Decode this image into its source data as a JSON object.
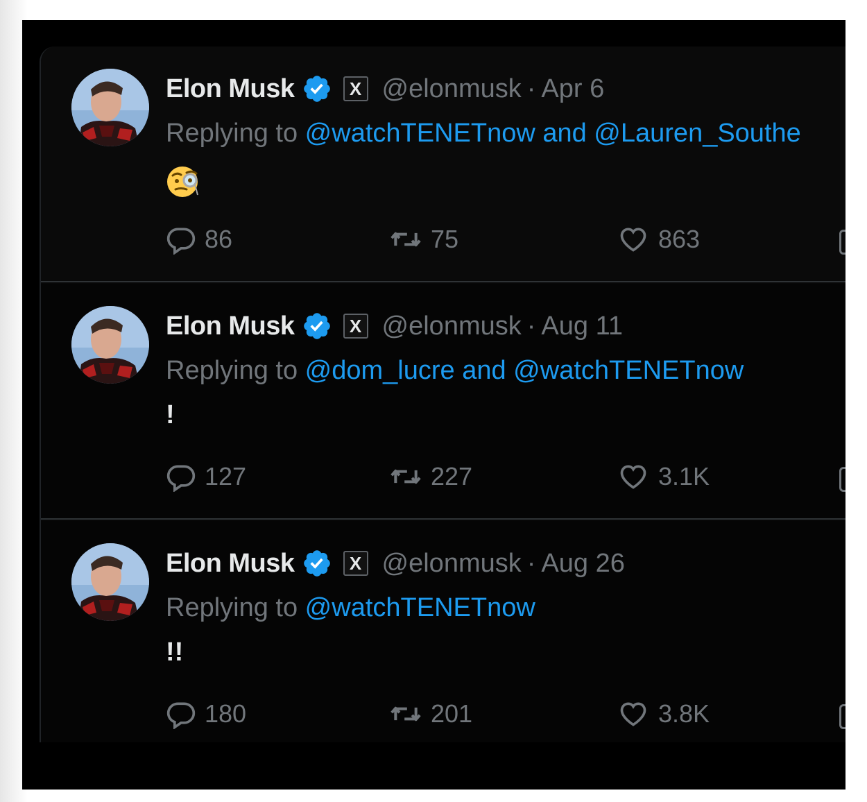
{
  "tweets": [
    {
      "author_name": "Elon Musk",
      "handle": "@elonmusk",
      "separator": "·",
      "date": "Apr 6",
      "replying_prefix": "Replying to ",
      "replying_mentions": "@watchTENETnow and @Lauren_Southe",
      "body": "",
      "body_emoji": "face-with-monocle-emoji",
      "reply_count": "86",
      "retweet_count": "75",
      "like_count": "863"
    },
    {
      "author_name": "Elon Musk",
      "handle": "@elonmusk",
      "separator": "·",
      "date": "Aug 11",
      "replying_prefix": "Replying to ",
      "replying_mentions": "@dom_lucre and @watchTENETnow",
      "body": "!",
      "reply_count": "127",
      "retweet_count": "227",
      "like_count": "3.1K"
    },
    {
      "author_name": "Elon Musk",
      "handle": "@elonmusk",
      "separator": "·",
      "date": "Aug 26",
      "replying_prefix": "Replying to ",
      "replying_mentions": "@watchTENETnow",
      "body": "!!",
      "reply_count": "180",
      "retweet_count": "201",
      "like_count": "3.8K"
    }
  ],
  "affiliation_badge": "X",
  "colors": {
    "background": "#000000",
    "text_primary": "#e7e9ea",
    "text_secondary": "#71767b",
    "mention": "#1d9bf0",
    "verified": "#1d9bf0",
    "divider": "#2f3336"
  },
  "icons": {
    "verified": "verified-badge-icon",
    "affiliation": "x-logo-icon",
    "reply": "reply-bubble-icon",
    "retweet": "retweet-icon",
    "like": "heart-icon"
  }
}
